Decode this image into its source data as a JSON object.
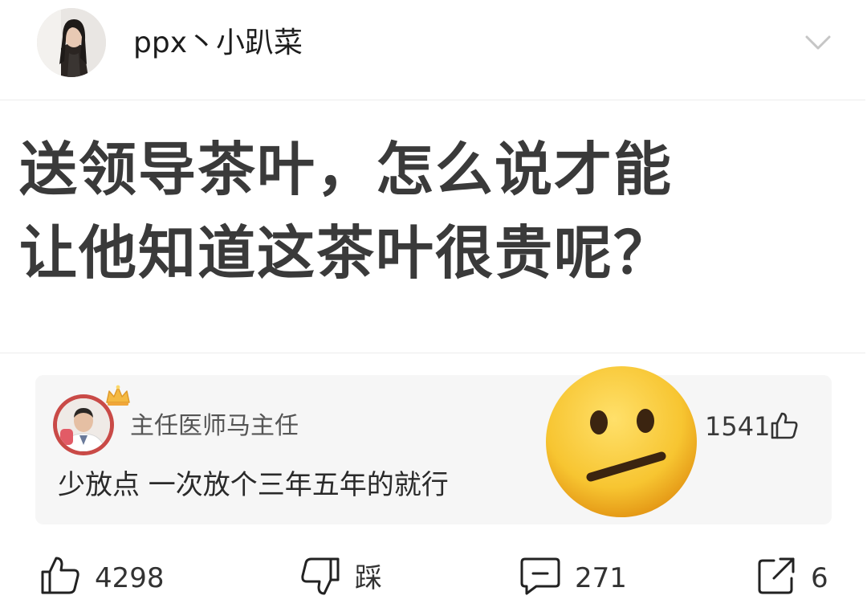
{
  "post": {
    "username": "ppx丶小趴菜",
    "title_line1": "送领导茶叶，怎么说才能",
    "title_line2": "让他知道这茶叶很贵呢？"
  },
  "comment": {
    "author": "主任医师马主任",
    "text": "少放点 一次放个三年五年的就行",
    "likes": "1541",
    "emoji": "neutral-face-emoji",
    "badge": "crown-icon"
  },
  "actions": {
    "like_count": "4298",
    "dislike_label": "踩",
    "comment_count": "271",
    "share_count": "6"
  },
  "colors": {
    "background": "#ffffff",
    "comment_bg": "#f6f6f6",
    "avatar_ring": "#c94a47",
    "emoji_yellow": "#f7c531"
  }
}
